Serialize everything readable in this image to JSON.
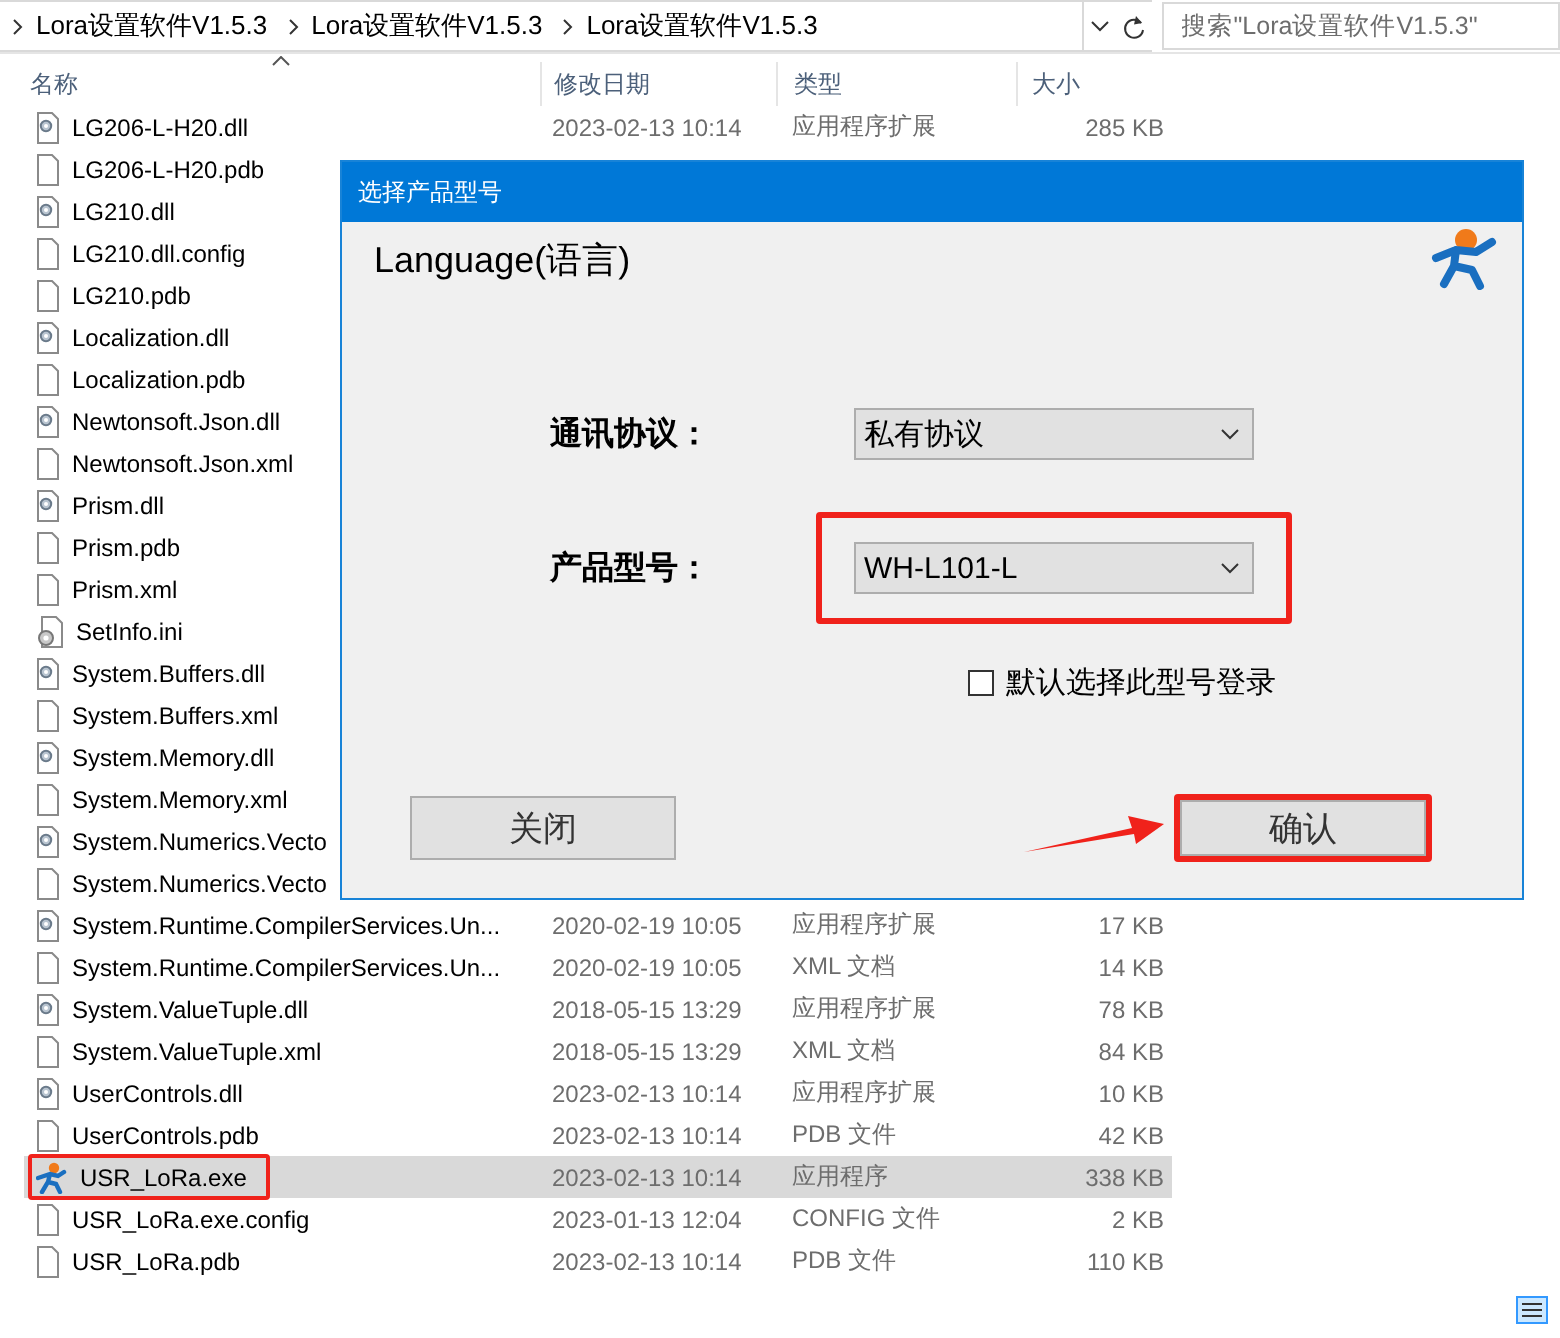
{
  "address_bar": {
    "breadcrumbs": [
      "Lora设置软件V1.5.3",
      "Lora设置软件V1.5.3",
      "Lora设置软件V1.5.3"
    ]
  },
  "search": {
    "placeholder": "搜索\"Lora设置软件V1.5.3\""
  },
  "columns": [
    {
      "label": "名称",
      "sorted": true
    },
    {
      "label": "修改日期",
      "sorted": false
    },
    {
      "label": "类型",
      "sorted": false
    },
    {
      "label": "大小",
      "sorted": false
    }
  ],
  "files": [
    {
      "name": "LG206-L-H20.dll",
      "kind": "dll",
      "selected": false,
      "highlighted": false,
      "date": "2023-02-13 10:14",
      "type": "应用程序扩展",
      "size": "285 KB"
    },
    {
      "name": "LG206-L-H20.pdb",
      "kind": "file",
      "selected": false,
      "highlighted": false
    },
    {
      "name": "LG210.dll",
      "kind": "dll",
      "selected": false,
      "highlighted": false
    },
    {
      "name": "LG210.dll.config",
      "kind": "file",
      "selected": false,
      "highlighted": false
    },
    {
      "name": "LG210.pdb",
      "kind": "file",
      "selected": false,
      "highlighted": false
    },
    {
      "name": "Localization.dll",
      "kind": "dll",
      "selected": false,
      "highlighted": false
    },
    {
      "name": "Localization.pdb",
      "kind": "file",
      "selected": false,
      "highlighted": false
    },
    {
      "name": "Newtonsoft.Json.dll",
      "kind": "dll",
      "selected": false,
      "highlighted": false
    },
    {
      "name": "Newtonsoft.Json.xml",
      "kind": "file",
      "selected": false,
      "highlighted": false
    },
    {
      "name": "Prism.dll",
      "kind": "dll",
      "selected": false,
      "highlighted": false
    },
    {
      "name": "Prism.pdb",
      "kind": "file",
      "selected": false,
      "highlighted": false
    },
    {
      "name": "Prism.xml",
      "kind": "file",
      "selected": false,
      "highlighted": false
    },
    {
      "name": "SetInfo.ini",
      "kind": "ini",
      "selected": false,
      "highlighted": false
    },
    {
      "name": "System.Buffers.dll",
      "kind": "dll",
      "selected": false,
      "highlighted": false
    },
    {
      "name": "System.Buffers.xml",
      "kind": "file",
      "selected": false,
      "highlighted": false
    },
    {
      "name": "System.Memory.dll",
      "kind": "dll",
      "selected": false,
      "highlighted": false
    },
    {
      "name": "System.Memory.xml",
      "kind": "file",
      "selected": false,
      "highlighted": false
    },
    {
      "name": "System.Numerics.Vecto",
      "kind": "dll",
      "selected": false,
      "highlighted": false
    },
    {
      "name": "System.Numerics.Vecto",
      "kind": "file",
      "selected": false,
      "highlighted": false
    },
    {
      "name": "System.Runtime.CompilerServices.Un...",
      "kind": "dll",
      "selected": false,
      "highlighted": false,
      "date": "2020-02-19 10:05",
      "type": "应用程序扩展",
      "size": "17 KB"
    },
    {
      "name": "System.Runtime.CompilerServices.Un...",
      "kind": "file",
      "selected": false,
      "highlighted": false,
      "date": "2020-02-19 10:05",
      "type": "XML 文档",
      "size": "14 KB"
    },
    {
      "name": "System.ValueTuple.dll",
      "kind": "dll",
      "selected": false,
      "highlighted": false,
      "date": "2018-05-15 13:29",
      "type": "应用程序扩展",
      "size": "78 KB"
    },
    {
      "name": "System.ValueTuple.xml",
      "kind": "file",
      "selected": false,
      "highlighted": false,
      "date": "2018-05-15 13:29",
      "type": "XML 文档",
      "size": "84 KB"
    },
    {
      "name": "UserControls.dll",
      "kind": "dll",
      "selected": false,
      "highlighted": false,
      "date": "2023-02-13 10:14",
      "type": "应用程序扩展",
      "size": "10 KB"
    },
    {
      "name": "UserControls.pdb",
      "kind": "file",
      "selected": false,
      "highlighted": false,
      "date": "2023-02-13 10:14",
      "type": "PDB 文件",
      "size": "42 KB"
    },
    {
      "name": "USR_LoRa.exe",
      "kind": "exe",
      "selected": true,
      "highlighted": true,
      "date": "2023-02-13 10:14",
      "type": "应用程序",
      "size": "338 KB"
    },
    {
      "name": "USR_LoRa.exe.config",
      "kind": "file",
      "selected": false,
      "highlighted": false,
      "date": "2023-01-13 12:04",
      "type": "CONFIG 文件",
      "size": "2 KB"
    },
    {
      "name": "USR_LoRa.pdb",
      "kind": "file",
      "selected": false,
      "highlighted": false,
      "date": "2023-02-13 10:14",
      "type": "PDB 文件",
      "size": "110 KB"
    }
  ],
  "dialog": {
    "title": "选择产品型号",
    "language": "Language(语言)",
    "fields": [
      {
        "label": "通讯协议：",
        "value": "私有协议",
        "highlighted": false
      },
      {
        "label": "产品型号：",
        "value": "WH-L101-L",
        "highlighted": true
      }
    ],
    "remember": {
      "label": "默认选择此型号登录",
      "checked": false
    },
    "buttons": [
      {
        "label": "关闭",
        "highlighted": false
      },
      {
        "label": "确认",
        "highlighted": true
      }
    ]
  }
}
